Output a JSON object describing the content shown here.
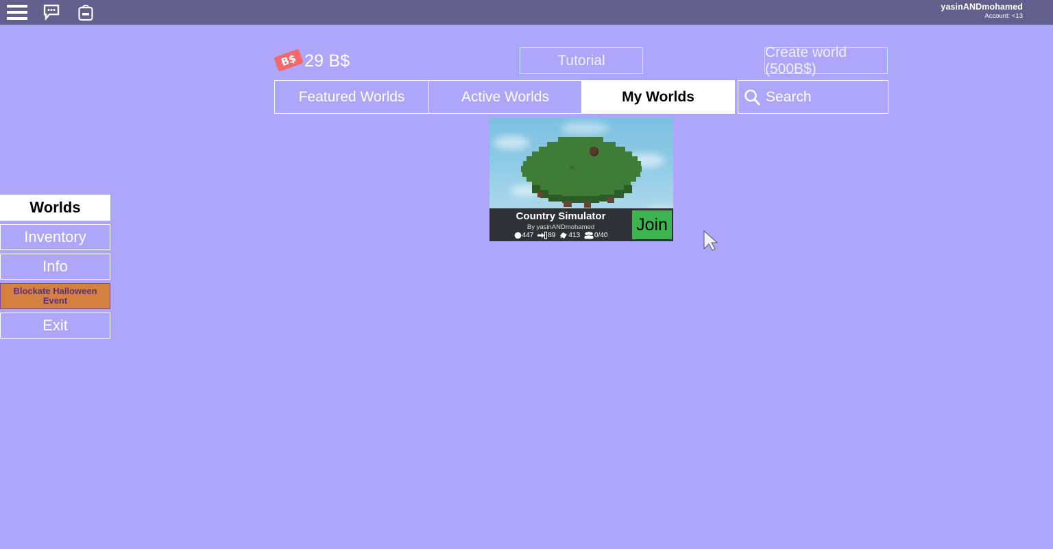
{
  "topbar": {
    "menu_icon": "hamburger-menu-icon",
    "chat_icon": "chat-bubble-icon",
    "backpack_icon": "backpack-icon",
    "account_name": "yasinANDmohamed",
    "account_sub": "Account: <13"
  },
  "currency": {
    "icon_label": "B$",
    "amount": "29 B$",
    "icon_color": "#f4676a"
  },
  "buttons": {
    "tutorial": "Tutorial",
    "create_world": "Create world (500B$)"
  },
  "tabs": [
    {
      "label": "Featured Worlds",
      "active": false
    },
    {
      "label": "Active Worlds",
      "active": false
    },
    {
      "label": "My Worlds",
      "active": true
    }
  ],
  "search": {
    "placeholder": "Search",
    "value": "",
    "icon": "search-icon"
  },
  "world_card": {
    "title": "Country Simulator",
    "author": "By yasinANDmohamed",
    "join_label": "Join",
    "join_color": "#3cb44f",
    "stats": [
      {
        "icon": "blob-visits-icon",
        "value": "447"
      },
      {
        "icon": "arrow-door-icon",
        "value": "89"
      },
      {
        "icon": "gem-icon",
        "value": "413"
      },
      {
        "icon": "players-icon",
        "value": "0/40"
      }
    ]
  },
  "sidebar": [
    {
      "label": "Worlds",
      "active": true,
      "style": "normal"
    },
    {
      "label": "Inventory",
      "active": false,
      "style": "normal"
    },
    {
      "label": "Info",
      "active": false,
      "style": "normal"
    },
    {
      "label": "Blockate Halloween Event",
      "active": false,
      "style": "event"
    },
    {
      "label": "Exit",
      "active": false,
      "style": "normal"
    }
  ],
  "theme": {
    "background": "#ada6fa",
    "topbar": "#625f8c",
    "event_orange": "#d4813f",
    "card_info_dark": "#2f3136"
  }
}
